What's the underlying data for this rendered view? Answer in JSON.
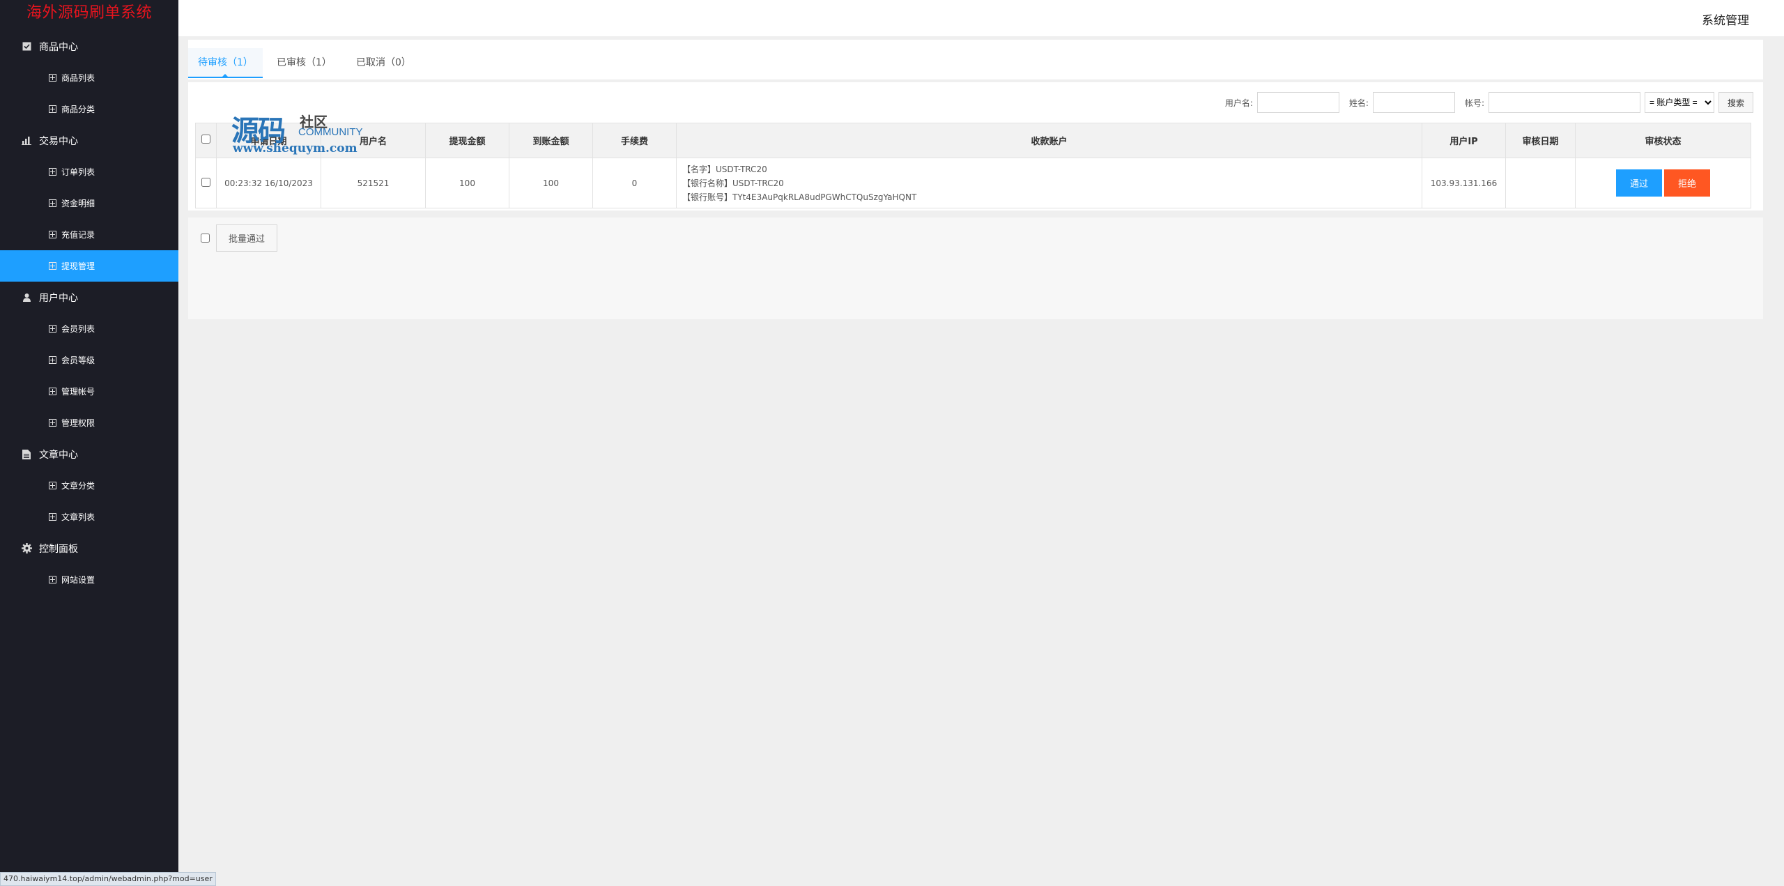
{
  "sidebar": {
    "logo": "海外源码刷单系统",
    "groups": [
      {
        "label": "商品中心",
        "icon": "checkbox-icon",
        "items": [
          {
            "label": "商品列表"
          },
          {
            "label": "商品分类"
          }
        ]
      },
      {
        "label": "交易中心",
        "icon": "bar-chart-icon",
        "items": [
          {
            "label": "订单列表"
          },
          {
            "label": "资金明细"
          },
          {
            "label": "充值记录"
          },
          {
            "label": "提现管理",
            "active": true
          }
        ]
      },
      {
        "label": "用户中心",
        "icon": "user-icon",
        "items": [
          {
            "label": "会员列表"
          },
          {
            "label": "会员等级"
          },
          {
            "label": "管理帐号"
          },
          {
            "label": "管理权限"
          }
        ]
      },
      {
        "label": "文章中心",
        "icon": "document-icon",
        "items": [
          {
            "label": "文章分类"
          },
          {
            "label": "文章列表"
          }
        ]
      },
      {
        "label": "控制面板",
        "icon": "gear-icon",
        "items": [
          {
            "label": "网站设置"
          }
        ]
      }
    ]
  },
  "header": {
    "title": "系统管理"
  },
  "tabs": [
    {
      "label": "待审核（1）",
      "active": true
    },
    {
      "label": "已审核（1）"
    },
    {
      "label": "已取消（0）"
    }
  ],
  "filters": {
    "username_label": "用户名:",
    "name_label": "姓名:",
    "account_label": "帐号:",
    "account_type": "= 账户类型 =",
    "search_label": "搜索"
  },
  "table": {
    "headers": [
      "申请日期",
      "用户名",
      "提现金额",
      "到账金额",
      "手续费",
      "收款账户",
      "用户IP",
      "审核日期",
      "审核状态"
    ],
    "rows": [
      {
        "date": "00:23:32 16/10/2023",
        "username": "521521",
        "amount": "100",
        "received": "100",
        "fee": "0",
        "account_lines": [
          "【名字】USDT-TRC20",
          "【银行名称】USDT-TRC20",
          "【银行账号】TYt4E3AuPqkRLA8udPGWhCTQuSzgYaHQNT"
        ],
        "ip": "103.93.131.166",
        "review_date": "",
        "approve_label": "通过",
        "reject_label": "拒绝"
      }
    ]
  },
  "batch": {
    "label": "批量通过"
  },
  "watermark": {
    "big": "源码",
    "small": "社区",
    "eng": "COMMUNITY",
    "url": "www.shequym.com"
  },
  "statusbar": {
    "url": "470.haiwaiym14.top/admin/webadmin.php?mod=user"
  },
  "colors": {
    "sidebar_bg": "#1c1d26",
    "accent": "#1e9fff",
    "danger": "#ff5722",
    "logo": "#e8141e"
  }
}
